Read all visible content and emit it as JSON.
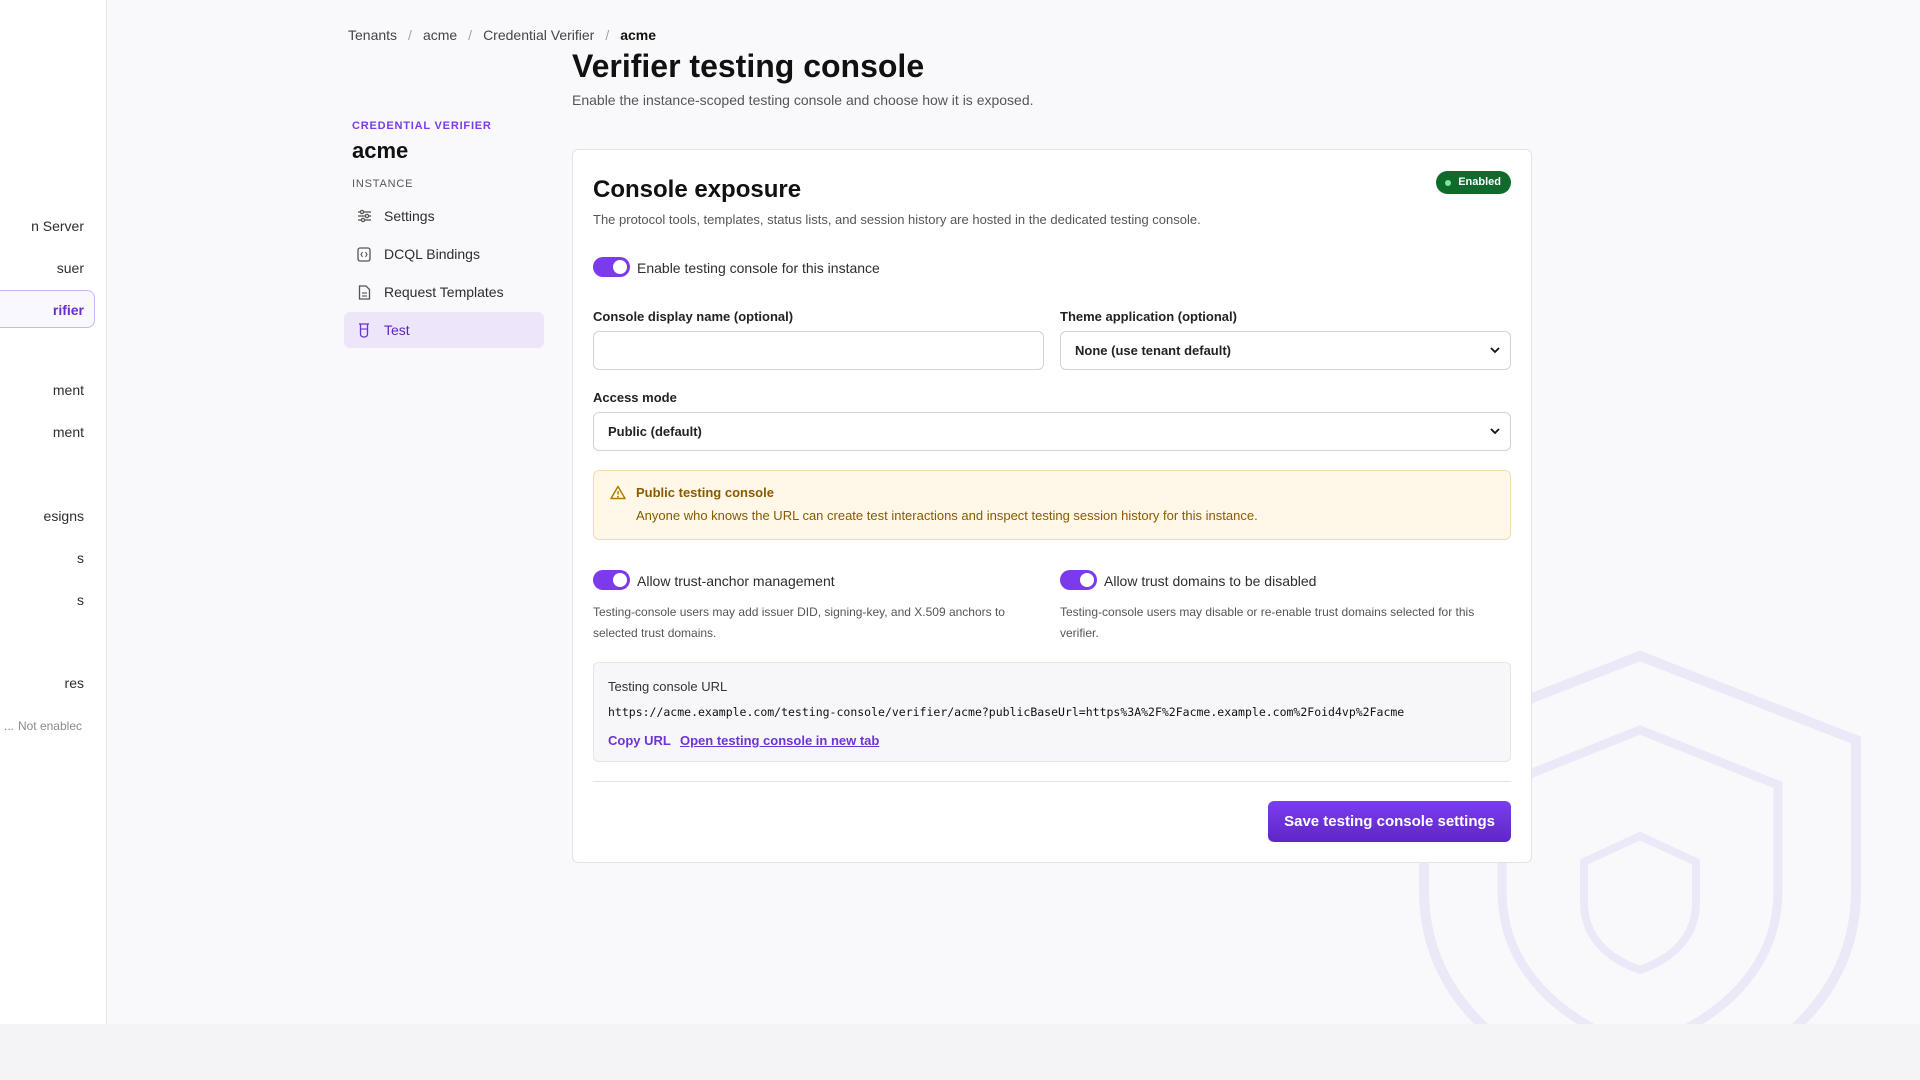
{
  "app_sidebar": {
    "items": [
      {
        "label": "n Server"
      },
      {
        "label": "suer"
      },
      {
        "label": "rifier"
      },
      {
        "label": "ment"
      },
      {
        "label": "ment"
      },
      {
        "label": "esigns"
      },
      {
        "label": "s"
      },
      {
        "label": "s"
      },
      {
        "label": "res"
      },
      {
        "label": "...",
        "status": "Not enablec"
      }
    ]
  },
  "breadcrumb": [
    "Tenants",
    "acme",
    "Credential Verifier",
    "acme"
  ],
  "sub_sidebar": {
    "label": "CREDENTIAL VERIFIER",
    "title": "acme",
    "section": "INSTANCE",
    "items": [
      {
        "label": "Settings",
        "icon": "sliders-icon"
      },
      {
        "label": "DCQL Bindings",
        "icon": "code-bracket-icon"
      },
      {
        "label": "Request Templates",
        "icon": "document-icon"
      },
      {
        "label": "Test",
        "icon": "flask-icon",
        "active": true
      }
    ]
  },
  "page": {
    "title": "Verifier testing console",
    "subtitle": "Enable the instance-scoped testing console and choose how it is exposed."
  },
  "card": {
    "title": "Console exposure",
    "description": "The protocol tools, templates, status lists, and session history are hosted in the dedicated testing console.",
    "badge": "Enabled",
    "enable_toggle": {
      "label": "Enable testing console for this instance",
      "on": true
    },
    "display_name": {
      "label": "Console display name (optional)",
      "value": "",
      "placeholder": ""
    },
    "theme": {
      "label": "Theme application (optional)",
      "selected": "None (use tenant default)"
    },
    "access_mode": {
      "label": "Access mode",
      "selected": "Public (default)"
    },
    "warning": {
      "title": "Public testing console",
      "text": "Anyone who knows the URL can create test interactions and inspect testing session history for this instance."
    },
    "trust_anchor_toggle": {
      "label": "Allow trust-anchor management",
      "on": true,
      "help": "Testing-console users may add issuer DID, signing-key, and X.509 anchors to selected trust domains."
    },
    "trust_domain_toggle": {
      "label": "Allow trust domains to be disabled",
      "on": true,
      "help": "Testing-console users may disable or re-enable trust domains selected for this verifier."
    },
    "url": {
      "label": "Testing console URL",
      "value": "https://acme.example.com/testing-console/verifier/acme?publicBaseUrl=https%3A%2F%2Facme.example.com%2Foid4vp%2Facme",
      "copy_label": "Copy URL",
      "open_label": "Open testing console in new tab"
    },
    "save_label": "Save testing console settings"
  },
  "colors": {
    "accent": "#7c3aed",
    "badge_bg": "#0f6b2c",
    "warning_bg": "#fff8e8",
    "warning_text": "#8a5a00"
  }
}
